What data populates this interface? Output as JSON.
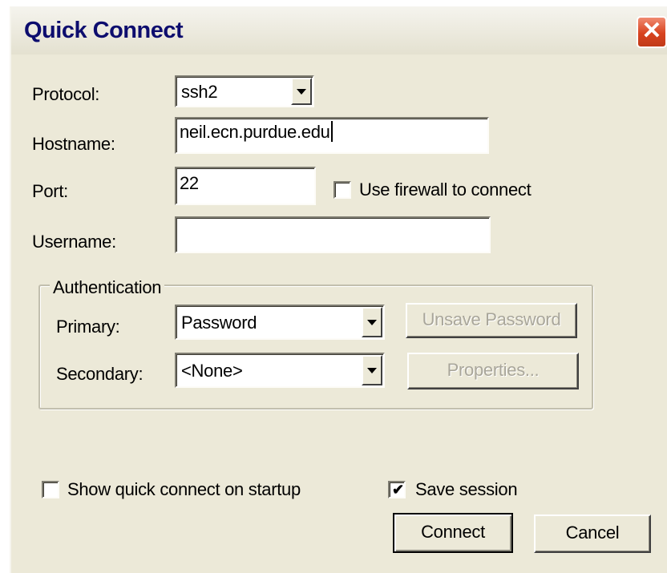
{
  "dialog": {
    "title": "Quick Connect",
    "close_glyph": "✕"
  },
  "protocol": {
    "label": "Protocol:",
    "value": "ssh2"
  },
  "hostname": {
    "label": "Hostname:",
    "value": "neil.ecn.purdue.edu"
  },
  "port": {
    "label": "Port:",
    "value": "22"
  },
  "firewall": {
    "label": "Use firewall to connect",
    "checked": false
  },
  "username": {
    "label": "Username:",
    "value": ""
  },
  "authentication": {
    "legend": "Authentication",
    "primary": {
      "label": "Primary:",
      "value": "Password"
    },
    "secondary": {
      "label": "Secondary:",
      "value": "<None>"
    },
    "unsave_password_button": "Unsave Password",
    "properties_button": "Properties..."
  },
  "options": {
    "show_on_startup": {
      "label": "Show quick connect on startup",
      "checked": false
    },
    "save_session": {
      "label": "Save session",
      "checked": true
    }
  },
  "actions": {
    "connect": "Connect",
    "cancel": "Cancel"
  },
  "colors": {
    "dialog_bg": "#ece9d8",
    "title_text": "#0d0d6e",
    "close_button": "#d8431f",
    "disabled_text": "#a9a69a"
  },
  "icons": {
    "dropdown": "chevron-down-icon",
    "close": "close-icon",
    "check": "checkmark-icon"
  }
}
